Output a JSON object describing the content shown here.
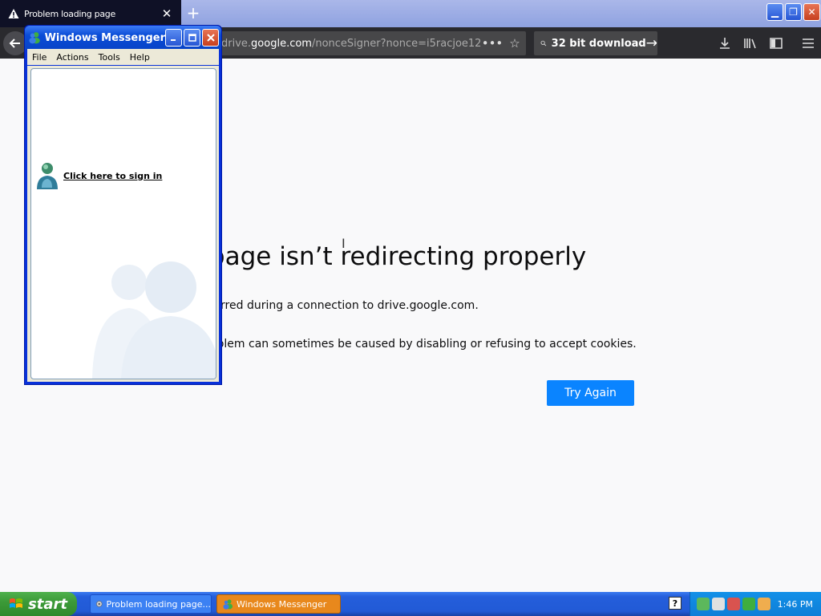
{
  "browser": {
    "tab": {
      "title": "Problem loading page",
      "close_glyph": "✕",
      "icon": "warning-icon"
    },
    "new_tab_glyph": "+",
    "window_buttons": {
      "minimize": "▁",
      "restore": "❐",
      "close": "✕"
    },
    "toolbar": {
      "url_prefix": "drive.",
      "url_domain": "google.com",
      "url_path": "/nonceSigner?nonce=i5racjoe12f",
      "page_actions_glyph": "•••",
      "bookmark_glyph": "☆",
      "search_query": "32 bit download",
      "search_go_glyph": "→",
      "icons": [
        "download-icon",
        "library-icon",
        "sidebar-icon",
        "menu-icon"
      ]
    }
  },
  "error_page": {
    "title": "e page isn’t redirecting properly",
    "message1": "r occurred during a connection to drive.google.com.",
    "message2": "is problem can sometimes be caused by disabling or refusing to accept cookies.",
    "try_again_label": "Try Again"
  },
  "messenger": {
    "title": "Windows Messenger",
    "menu": [
      "File",
      "Actions",
      "Tools",
      "Help"
    ],
    "sign_in_link": "Click here to sign in"
  },
  "taskbar": {
    "start_label": "start",
    "tasks": [
      {
        "label": "Problem loading page..."
      },
      {
        "label": "Windows Messenger"
      }
    ],
    "help_glyph": "?",
    "clock": "1:46 PM"
  }
}
